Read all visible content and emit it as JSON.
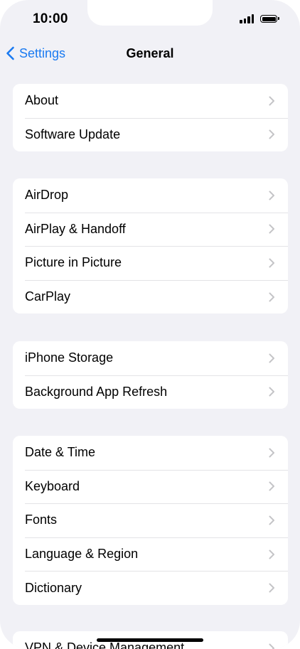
{
  "status_bar": {
    "time": "10:00"
  },
  "navbar": {
    "back_label": "Settings",
    "title": "General"
  },
  "groups": [
    {
      "items": [
        {
          "label": "About"
        },
        {
          "label": "Software Update"
        }
      ]
    },
    {
      "items": [
        {
          "label": "AirDrop"
        },
        {
          "label": "AirPlay & Handoff"
        },
        {
          "label": "Picture in Picture"
        },
        {
          "label": "CarPlay"
        }
      ]
    },
    {
      "items": [
        {
          "label": "iPhone Storage"
        },
        {
          "label": "Background App Refresh"
        }
      ]
    },
    {
      "items": [
        {
          "label": "Date & Time"
        },
        {
          "label": "Keyboard"
        },
        {
          "label": "Fonts"
        },
        {
          "label": "Language & Region"
        },
        {
          "label": "Dictionary"
        }
      ]
    },
    {
      "items": [
        {
          "label": "VPN & Device Management"
        }
      ]
    }
  ],
  "colors": {
    "accent": "#1a7af1",
    "background": "#f1f1f6",
    "cell": "#ffffff",
    "separator": "#e3e3e6",
    "chevron": "#c4c4c7"
  },
  "icons": {
    "back": "chevron-left-icon",
    "disclosure": "chevron-right-icon",
    "signal": "cellular-signal-icon",
    "battery": "battery-icon"
  }
}
